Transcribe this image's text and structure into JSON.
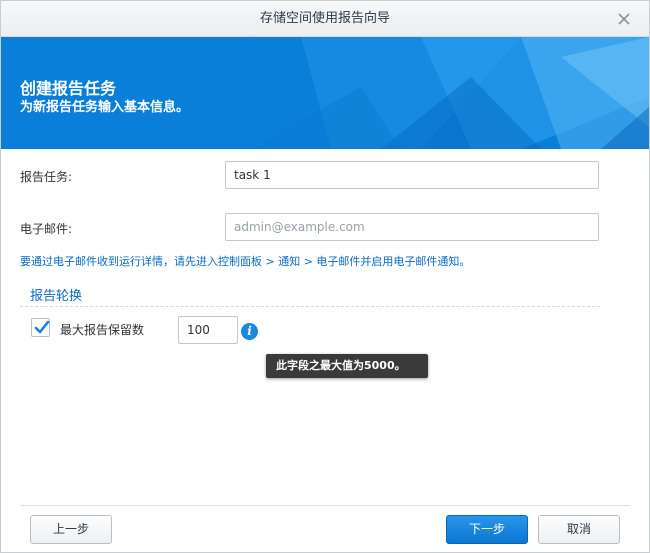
{
  "window": {
    "title": "存储空间使用报告向导"
  },
  "banner": {
    "title": "创建报告任务",
    "subtitle": "为新报告任务输入基本信息。"
  },
  "form": {
    "task_label": "报告任务:",
    "task_value": "task 1",
    "email_label": "电子邮件:",
    "email_placeholder": "admin@example.com",
    "hint": "要通过电子邮件收到运行详情，请先进入控制面板 > 通知 > 电子邮件并启用电子邮件通知。"
  },
  "rotation": {
    "section_title": "报告轮换",
    "max_reports_label": "最大报告保留数",
    "max_reports_checked": true,
    "max_reports_value": "100",
    "tooltip": "此字段之最大值为5000。"
  },
  "footer": {
    "back_label": "上一步",
    "next_label": "下一步",
    "cancel_label": "取消"
  },
  "colors": {
    "accent": "#0a7fd9",
    "link": "#0a6cc4"
  }
}
